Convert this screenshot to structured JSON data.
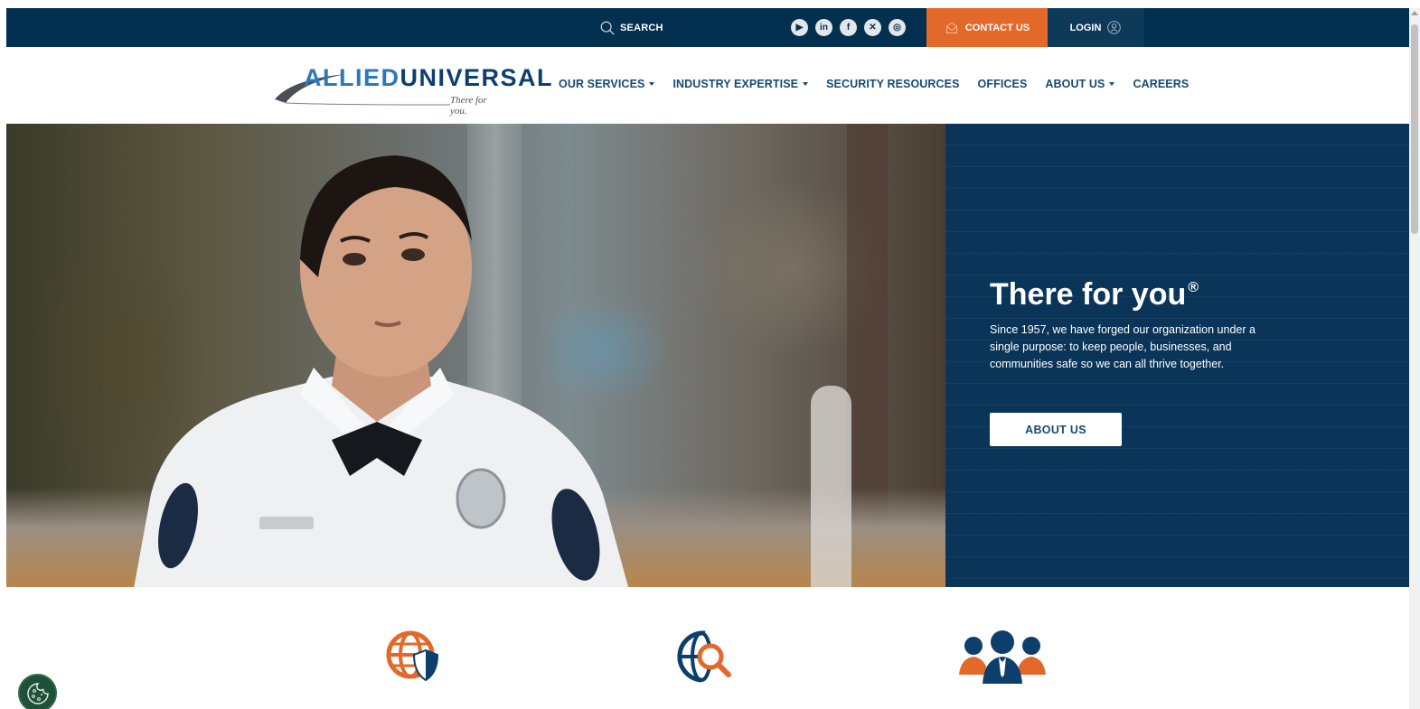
{
  "topbar": {
    "search_label": "SEARCH",
    "social": [
      {
        "name": "youtube-icon",
        "glyph": "▶"
      },
      {
        "name": "linkedin-icon",
        "glyph": "in"
      },
      {
        "name": "facebook-icon",
        "glyph": "f"
      },
      {
        "name": "x-icon",
        "glyph": "✕"
      },
      {
        "name": "instagram-icon",
        "glyph": "◎"
      }
    ],
    "contact_label": "CONTACT US",
    "login_label": "LOGIN"
  },
  "logo": {
    "allied": "ALLIED",
    "universal": "UNIVERSAL",
    "tagline": "There for you."
  },
  "nav": {
    "items": [
      {
        "label": "OUR SERVICES",
        "dropdown": true
      },
      {
        "label": "INDUSTRY EXPERTISE",
        "dropdown": true
      },
      {
        "label": "SECURITY RESOURCES",
        "dropdown": false
      },
      {
        "label": "OFFICES",
        "dropdown": false
      },
      {
        "label": "ABOUT US",
        "dropdown": true
      },
      {
        "label": "CAREERS",
        "dropdown": false
      }
    ]
  },
  "hero": {
    "title": "There for you",
    "title_mark": "®",
    "body": "Since 1957, we have forged our organization under a single purpose: to keep people, businesses, and communities safe so we can all thrive together.",
    "button_label": "ABOUT US"
  },
  "colors": {
    "navy": "#04304f",
    "orange": "#e2692a",
    "panel": "#0b3558",
    "nav_text": "#134b75"
  },
  "features": [
    {
      "icon": "globe-shield-icon"
    },
    {
      "icon": "globe-search-icon"
    },
    {
      "icon": "team-icon"
    }
  ]
}
